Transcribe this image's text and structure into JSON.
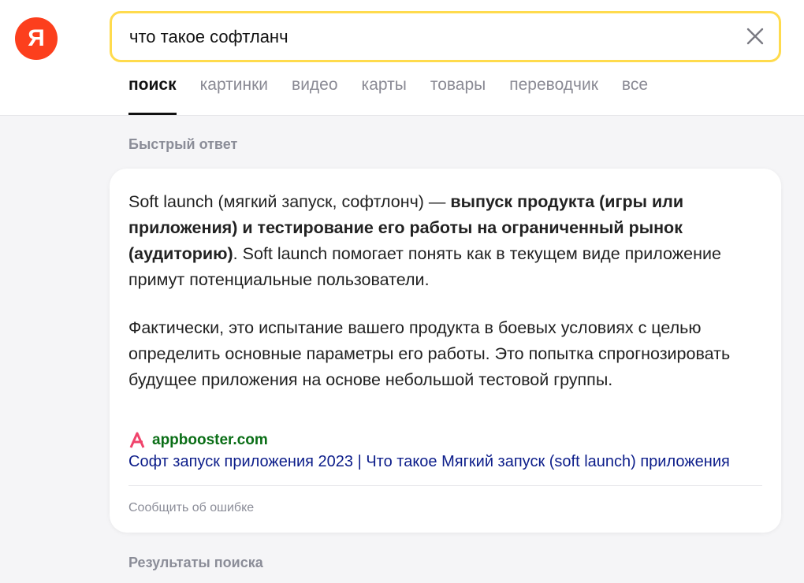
{
  "logo": {
    "letter": "Я"
  },
  "search": {
    "value": "что такое софтланч"
  },
  "tabs": [
    {
      "label": "поиск"
    },
    {
      "label": "картинки"
    },
    {
      "label": "видео"
    },
    {
      "label": "карты"
    },
    {
      "label": "товары"
    },
    {
      "label": "переводчик"
    },
    {
      "label": "все"
    }
  ],
  "quick_answer": {
    "section_title": "Быстрый ответ",
    "p1_intro": "Soft launch (мягкий запуск, софтлонч) — ",
    "p1_bold": "выпуск продукта (игры или приложения) и тестирование его работы на ограниченный рынок (аудиторию)",
    "p1_rest": ". Soft launch помогает понять как в текущем виде приложение примут потенциальные пользователи.",
    "p2": "Фактически, это испытание вашего продукта в боевых условиях с целью определить основные параметры его работы. Это попытка спрогнозировать будущее приложения на основе небольшой тестовой группы.",
    "source_domain": "appbooster.com",
    "source_title": "Софт запуск приложения 2023 | Что такое Мягкий запуск (soft launch) приложения",
    "report_label": "Сообщить об ошибке"
  },
  "results": {
    "section_title": "Результаты поиска"
  },
  "colors": {
    "logo": "#fc3f1d",
    "search_border": "#ffdb4d",
    "domain": "#0a6e16",
    "link": "#0c1d8a",
    "source_icon": "#f0436b"
  }
}
